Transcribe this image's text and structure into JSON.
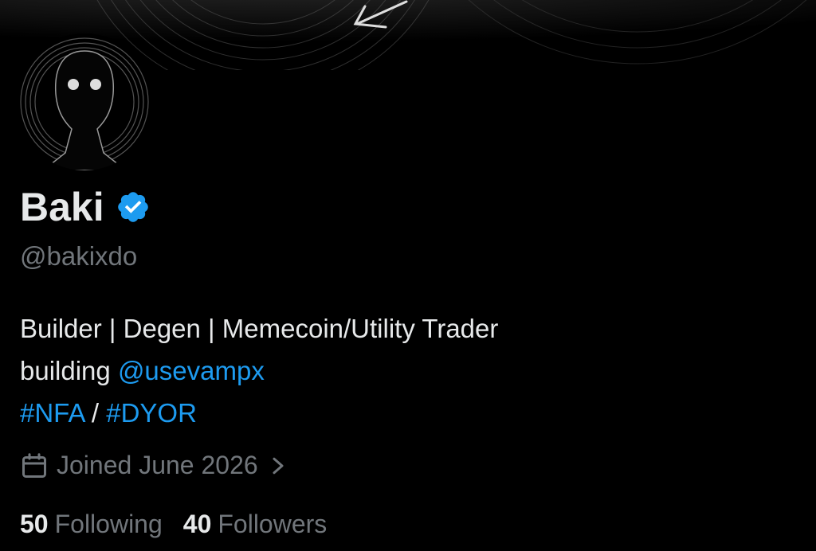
{
  "profile": {
    "display_name": "Baki",
    "handle": "@bakixdo",
    "verified_icon": "verified-badge-icon",
    "bio": {
      "line1": "Builder | Degen | Memecoin/Utility Trader",
      "line2_prefix": "building ",
      "line2_mention": "@usevampx",
      "tag1": "#NFA",
      "separator": " / ",
      "tag2": "#DYOR"
    },
    "joined": "Joined June 2026",
    "following_count": "50",
    "following_label": "Following",
    "followers_count": "40",
    "followers_label": "Followers"
  },
  "icons": {
    "calendar": "calendar-icon",
    "chevron": "chevron-right-icon",
    "banner_arrow": "arrow-icon"
  },
  "colors": {
    "background": "#000000",
    "primary_text": "#e7e9ea",
    "secondary_text": "#71767b",
    "link": "#1d9bf0",
    "verified": "#1d9bf0"
  }
}
